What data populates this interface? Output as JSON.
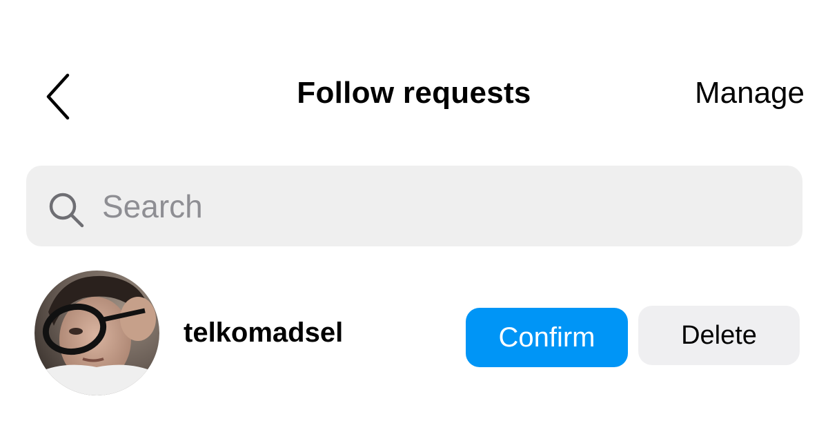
{
  "header": {
    "title": "Follow requests",
    "manage_label": "Manage",
    "back_icon": "chevron-left-icon"
  },
  "search": {
    "placeholder": "Search",
    "value": "",
    "icon": "search-icon"
  },
  "requests": [
    {
      "username": "telkomadsel",
      "confirm_label": "Confirm",
      "delete_label": "Delete"
    }
  ],
  "colors": {
    "accent": "#0095f6",
    "search_bg": "#efefef",
    "delete_bg": "#efeff1",
    "placeholder": "#8e8e93"
  }
}
